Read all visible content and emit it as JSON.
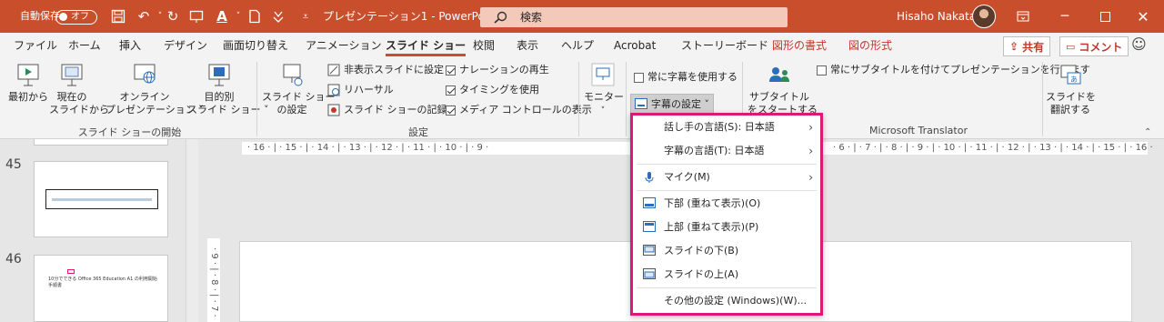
{
  "titlebar": {
    "autosave": "自動保存",
    "toggle": "オフ",
    "doc_title": "プレゼンテーション1 - PowerPo...",
    "search": "検索",
    "user": "Hisaho Nakata"
  },
  "tabs": [
    "ファイル",
    "ホーム",
    "挿入",
    "デザイン",
    "画面切り替え",
    "アニメーション",
    "スライド ショー",
    "校閲",
    "表示",
    "ヘルプ",
    "Acrobat",
    "ストーリーボード",
    "図形の書式",
    "図の形式"
  ],
  "share": "共有",
  "comment": "コメント",
  "ribbon": {
    "from_start": "最初から",
    "from_current_1": "現在の",
    "from_current_2": "スライドから",
    "online_1": "オンライン",
    "online_2": "プレゼンテーション ˅",
    "custom_1": "目的別",
    "custom_2": "スライド ショー ˅",
    "group_start": "スライド ショーの開始",
    "setup_1": "スライド ショー",
    "setup_2": "の設定",
    "hide_slide": "非表示スライドに設定",
    "rehearse": "リハーサル",
    "record": "スライド ショーの記録",
    "narration": "ナレーションの再生",
    "timing": "タイミングを使用",
    "media": "メディア コントロールの表示",
    "group_setup": "設定",
    "monitor": "モニター",
    "always_caption": "常に字幕を使用する",
    "caption_settings": "字幕の設定 ˅",
    "subtitle_1": "サブタイトル",
    "subtitle_2": "をスタートする",
    "always_subtitle": "常にサブタイトルを付けてプレゼンテーションを行います",
    "translate_1": "スライドを",
    "translate_2": "翻訳する",
    "group_translator": "Microsoft Translator"
  },
  "slides": {
    "n45": "45",
    "n46": "46",
    "thumb_text": "10分でできる Office 365 Education A1 の利用開始手順書"
  },
  "ruler": {
    "left": "· 16 · | · 15 · | · 14 · | · 13 · | · 12 · | · 11 · | · 10 · | · 9 ·",
    "right": "· 6 · | · 7 · | · 8 · | · 9 · | · 10 · | · 11 · | · 12 · | · 13 · | · 14 · | · 15 · | · 16 ·"
  },
  "menu": {
    "speaker_lang": "話し手の言語(S): 日本語",
    "caption_lang": "字幕の言語(T): 日本語",
    "mic": "マイク(M)",
    "bottom_overlay": "下部 (重ねて表示)(O)",
    "top_overlay": "上部 (重ねて表示)(P)",
    "below_slide": "スライドの下(B)",
    "above_slide": "スライドの上(A)",
    "more": "その他の設定 (Windows)(W)..."
  },
  "colors": {
    "accent": "#c94f2c",
    "highlight": "#e0177a"
  }
}
